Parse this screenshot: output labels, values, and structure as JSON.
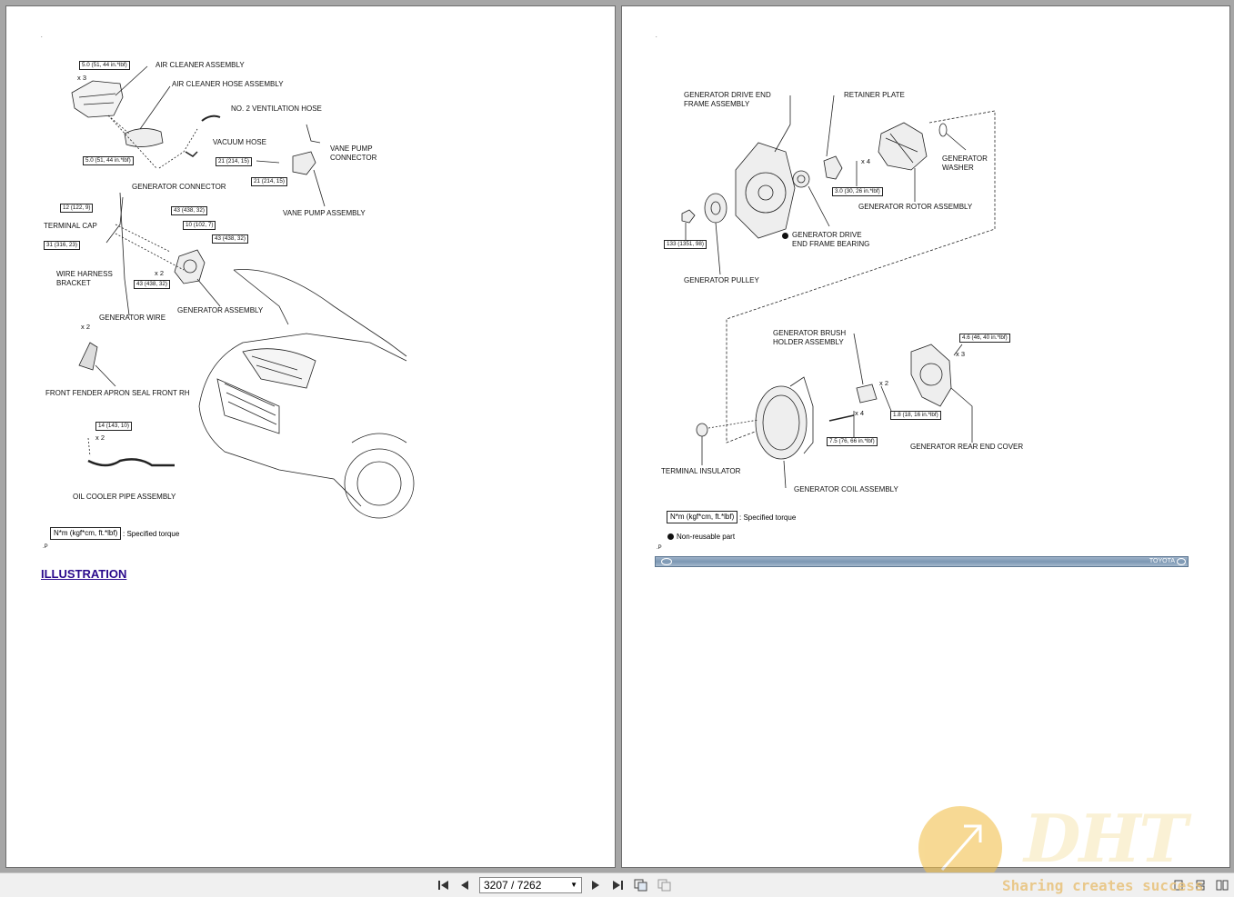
{
  "left_page": {
    "mark_top": ".",
    "labels": {
      "air_cleaner_assembly": "AIR CLEANER ASSEMBLY",
      "air_cleaner_hose_assembly": "AIR CLEANER HOSE ASSEMBLY",
      "no2_ventilation_hose": "NO. 2 VENTILATION HOSE",
      "vacuum_hose": "VACUUM HOSE",
      "vane_pump_connector_1": "VANE PUMP",
      "vane_pump_connector_2": "CONNECTOR",
      "vane_pump_assembly": "VANE PUMP ASSEMBLY",
      "generator_connector": "GENERATOR CONNECTOR",
      "terminal_cap": "TERMINAL CAP",
      "wire_harness_bracket_1": "WIRE HARNESS",
      "wire_harness_bracket_2": "BRACKET",
      "generator_wire": "GENERATOR WIRE",
      "generator_assembly": "GENERATOR ASSEMBLY",
      "front_fender_apron_seal": "FRONT FENDER APRON SEAL FRONT RH",
      "oil_cooler_pipe_assembly": "OIL COOLER PIPE ASSEMBLY"
    },
    "torques": {
      "t_air_cleaner_1": "5.0 (51, 44 in.*lbf)",
      "t_air_cleaner_2": "5.0 (51, 44 in.*lbf)",
      "t_vane_1": "21 (214, 15)",
      "t_vane_2": "21 (214, 15)",
      "t_terminal_cap": "12 (122, 9)",
      "t_bracket": "31 (316, 23)",
      "t_gen_1": "43 (438, 32)",
      "t_gen_2": "10 (102, 7)",
      "t_gen_3": "43 (438, 32)",
      "t_gen_4": "43 (438, 32)",
      "t_oil_cooler": "14 (143, 10)"
    },
    "quantities": {
      "q_air": "x 3",
      "q_gen": "x 2",
      "q_fender": "x 2",
      "q_oil": "x 2"
    },
    "legend_box": "N*m (kgf*cm, ft.*lbf)",
    "legend_text": ": Specified torque",
    "mark_p": ".P",
    "illustration_link": "ILLUSTRATION"
  },
  "right_page": {
    "mark_top": ".",
    "labels": {
      "gen_drive_end_frame_1": "GENERATOR DRIVE END",
      "gen_drive_end_frame_2": "FRAME ASSEMBLY",
      "retainer_plate": "RETAINER PLATE",
      "generator_washer_1": "GENERATOR",
      "generator_washer_2": "WASHER",
      "gen_rotor_assembly": "GENERATOR ROTOR ASSEMBLY",
      "gen_drive_bearing_1": "GENERATOR DRIVE",
      "gen_drive_bearing_2": "END FRAME BEARING",
      "generator_pulley": "GENERATOR PULLEY",
      "gen_brush_holder_1": "GENERATOR BRUSH",
      "gen_brush_holder_2": "HOLDER ASSEMBLY",
      "gen_rear_end_cover": "GENERATOR REAR END COVER",
      "terminal_insulator": "TERMINAL INSULATOR",
      "gen_coil_assembly": "GENERATOR COIL ASSEMBLY"
    },
    "torques": {
      "t_retainer": "3.0 (30, 26 in.*lbf)",
      "t_pulley": "133 (1351, 98)",
      "t_cover": "4.6 (46, 40 in.*lbf)",
      "t_brush": "1.8 (18, 16 in.*lbf)",
      "t_coil": "7.5 (76, 66 in.*lbf)"
    },
    "quantities": {
      "q_retainer": "x 4",
      "q_cover": "x 3",
      "q_brush": "x 2",
      "q_coil": "x 4"
    },
    "legend_box": "N*m (kgf*cm, ft.*lbf)",
    "legend_text": ": Specified torque",
    "nonreusable_text": "Non-reusable part",
    "mark_p": ".P",
    "footer_brand": "TOYOTA"
  },
  "toolbar": {
    "page_indicator": "3207 / 7262",
    "icons": [
      "first-page-icon",
      "prev-page-icon",
      "next-page-icon",
      "last-page-icon",
      "copy-icon",
      "paste-icon"
    ]
  },
  "watermark": {
    "logo_text": "DHT",
    "tagline": "Sharing creates success"
  }
}
